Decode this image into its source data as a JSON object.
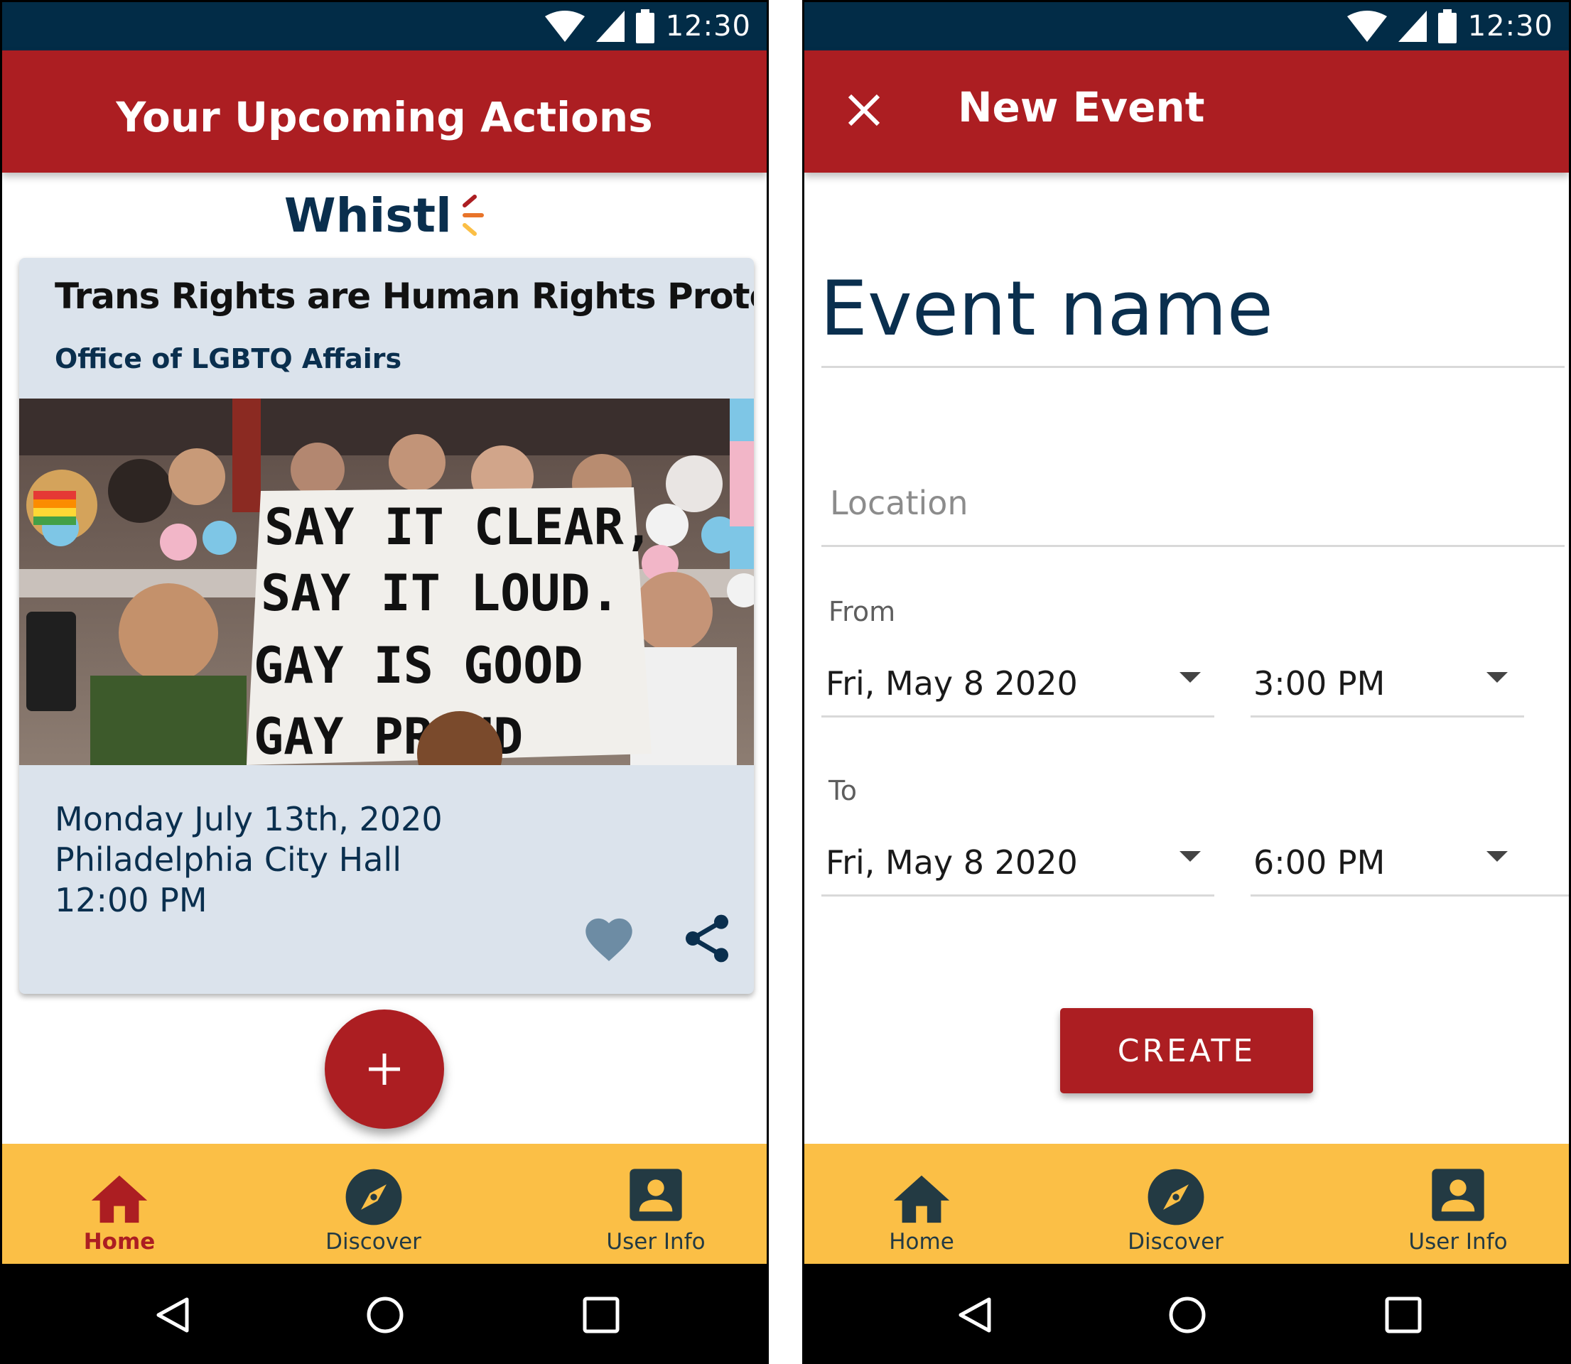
{
  "status_bar": {
    "time": "12:30"
  },
  "left_screen": {
    "appbar_title": "Your Upcoming Actions",
    "logo_text": "Whistl",
    "card": {
      "title": "Trans Rights are Human Rights Protest",
      "organization": "Office of LGBTQ Affairs",
      "sign_lines": [
        "SAY IT CLEAR,",
        "SAY IT LOUD.",
        "GAY IS GOOD",
        "GAY PROUD"
      ],
      "date": "Monday July 13th, 2020",
      "location": "Philadelphia City Hall",
      "time": "12:00 PM"
    },
    "fab_icon": "plus-icon"
  },
  "right_screen": {
    "appbar_title": "New Event",
    "close_icon": "close-icon",
    "event_name": "Event name",
    "location_placeholder": "Location",
    "from_label": "From",
    "from_date": "Fri, May 8 2020",
    "from_time": "3:00 PM",
    "to_label": "To",
    "to_date": "Fri, May 8 2020",
    "to_time": "6:00 PM",
    "create_label": "CREATE"
  },
  "bottom_nav": {
    "items": [
      {
        "label": "Home",
        "icon": "home-icon"
      },
      {
        "label": "Discover",
        "icon": "compass-icon"
      },
      {
        "label": "User Info",
        "icon": "user-icon"
      }
    ]
  },
  "colors": {
    "status_bar": "#022c47",
    "primary_red": "#ac1e22",
    "nav_yellow": "#fbbf46",
    "card_bg": "#dbe3ec",
    "navy_text": "#0a2f4e",
    "nav_icon": "#233a43",
    "heart": "#6d8ca4"
  }
}
